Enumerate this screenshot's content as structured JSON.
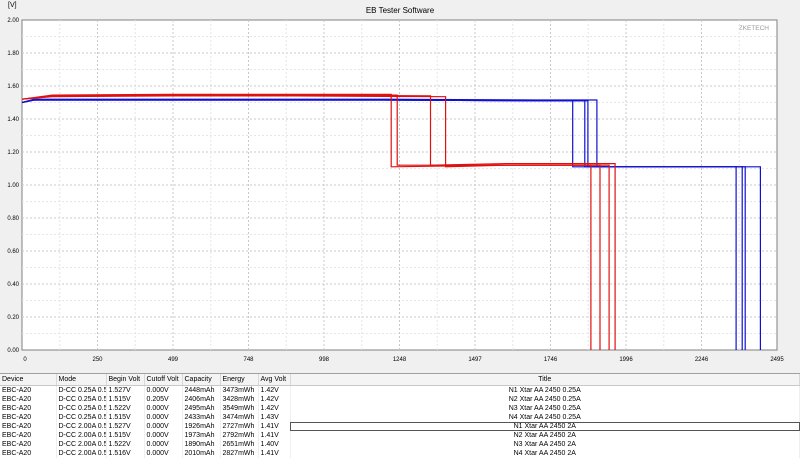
{
  "window": {
    "title": "EB Tester Software",
    "watermark": "ZKETECH"
  },
  "chart_data": {
    "type": "line",
    "title": "EB Tester Software",
    "ylabel": "[V]",
    "xlabel": "",
    "xlim": [
      0,
      2495
    ],
    "ylim": [
      0,
      2.0
    ],
    "grid": true,
    "xticks": [
      "0",
      "250",
      "499",
      "748",
      "998",
      "1248",
      "1497",
      "1746",
      "1996",
      "2246",
      "2495"
    ],
    "yticks": [
      "0.00",
      "0.20",
      "0.40",
      "0.60",
      "0.80",
      "1.00",
      "1.20",
      "1.40",
      "1.60",
      "1.80",
      "2.00"
    ],
    "series": [
      {
        "color": "#1010d0",
        "x": [
          0,
          40,
          250,
          800,
          1200,
          1700,
          1860,
          1860,
          2300,
          2360,
          2360
        ],
        "y": [
          1.5,
          1.515,
          1.515,
          1.515,
          1.515,
          1.51,
          1.51,
          1.11,
          1.11,
          1.11,
          0.0
        ]
      },
      {
        "color": "#1010d0",
        "x": [
          0,
          40,
          250,
          800,
          1200,
          1700,
          1820,
          1820,
          2300,
          2390,
          2390
        ],
        "y": [
          1.5,
          1.515,
          1.515,
          1.515,
          1.515,
          1.51,
          1.51,
          1.11,
          1.11,
          1.11,
          0.0
        ]
      },
      {
        "color": "#1010d0",
        "x": [
          0,
          40,
          250,
          800,
          1200,
          1700,
          1900,
          1900,
          2300,
          2440,
          2440
        ],
        "y": [
          1.5,
          1.52,
          1.52,
          1.52,
          1.52,
          1.515,
          1.515,
          1.11,
          1.11,
          1.11,
          0.0
        ]
      },
      {
        "color": "#1010d0",
        "x": [
          0,
          40,
          250,
          800,
          1200,
          1700,
          1870,
          1870,
          2300,
          2380,
          2380
        ],
        "y": [
          1.5,
          1.515,
          1.515,
          1.515,
          1.515,
          1.51,
          1.51,
          1.11,
          1.11,
          1.11,
          0.0
        ]
      },
      {
        "color": "#e01010",
        "x": [
          0,
          100,
          500,
          900,
          1220,
          1220,
          1600,
          1880,
          1880
        ],
        "y": [
          1.52,
          1.545,
          1.55,
          1.55,
          1.55,
          1.11,
          1.12,
          1.12,
          0.0
        ]
      },
      {
        "color": "#e01010",
        "x": [
          0,
          100,
          500,
          900,
          1240,
          1240,
          1600,
          1910,
          1910
        ],
        "y": [
          1.52,
          1.54,
          1.545,
          1.545,
          1.545,
          1.12,
          1.12,
          1.12,
          0.0
        ]
      },
      {
        "color": "#e01010",
        "x": [
          0,
          100,
          500,
          900,
          1350,
          1350,
          1600,
          1960,
          1960
        ],
        "y": [
          1.52,
          1.54,
          1.545,
          1.545,
          1.54,
          1.12,
          1.13,
          1.13,
          0.0
        ]
      },
      {
        "color": "#e01010",
        "x": [
          0,
          100,
          500,
          900,
          1400,
          1400,
          1600,
          1940,
          1940
        ],
        "y": [
          1.52,
          1.535,
          1.54,
          1.54,
          1.535,
          1.11,
          1.12,
          1.12,
          0.0
        ]
      }
    ]
  },
  "table": {
    "columns": [
      "Device",
      "Mode",
      "Begin Volt",
      "Cutoff Volt",
      "Capacity",
      "Energy",
      "Avg Volt",
      "Title"
    ],
    "rows": [
      [
        "EBC-A20",
        "D-CC  0.25A  0.50V",
        "1.527V",
        "0.000V",
        "2448mAh",
        "3473mWh",
        "1.42V",
        "N1 Xtar AA 2450 0.25A"
      ],
      [
        "EBC-A20",
        "D-CC  0.25A  0.50V",
        "1.515V",
        "0.205V",
        "2406mAh",
        "3428mWh",
        "1.42V",
        "N2 Xtar AA 2450 0.25A"
      ],
      [
        "EBC-A20",
        "D-CC  0.25A  0.50V",
        "1.522V",
        "0.000V",
        "2495mAh",
        "3549mWh",
        "1.42V",
        "N3 Xtar AA 2450 0.25A"
      ],
      [
        "EBC-A20",
        "D-CC  0.25A  0.50V",
        "1.515V",
        "0.000V",
        "2433mAh",
        "3474mWh",
        "1.43V",
        "N4 Xtar AA 2450 0.25A"
      ],
      [
        "EBC-A20",
        "D-CC  2.00A  0.50V",
        "1.527V",
        "0.000V",
        "1926mAh",
        "2727mWh",
        "1.41V",
        "N1 Xtar AA 2450 2A"
      ],
      [
        "EBC-A20",
        "D-CC  2.00A  0.50V",
        "1.515V",
        "0.000V",
        "1973mAh",
        "2792mWh",
        "1.41V",
        "N2 Xtar AA 2450 2A"
      ],
      [
        "EBC-A20",
        "D-CC  2.00A  0.50V",
        "1.522V",
        "0.000V",
        "1890mAh",
        "2651mWh",
        "1.40V",
        "N3 Xtar AA 2450 2A"
      ],
      [
        "EBC-A20",
        "D-CC  2.00A  0.50V",
        "1.516V",
        "0.000V",
        "2010mAh",
        "2827mWh",
        "1.41V",
        "N4 Xtar AA 2450 2A"
      ]
    ],
    "selected_row": 4
  }
}
